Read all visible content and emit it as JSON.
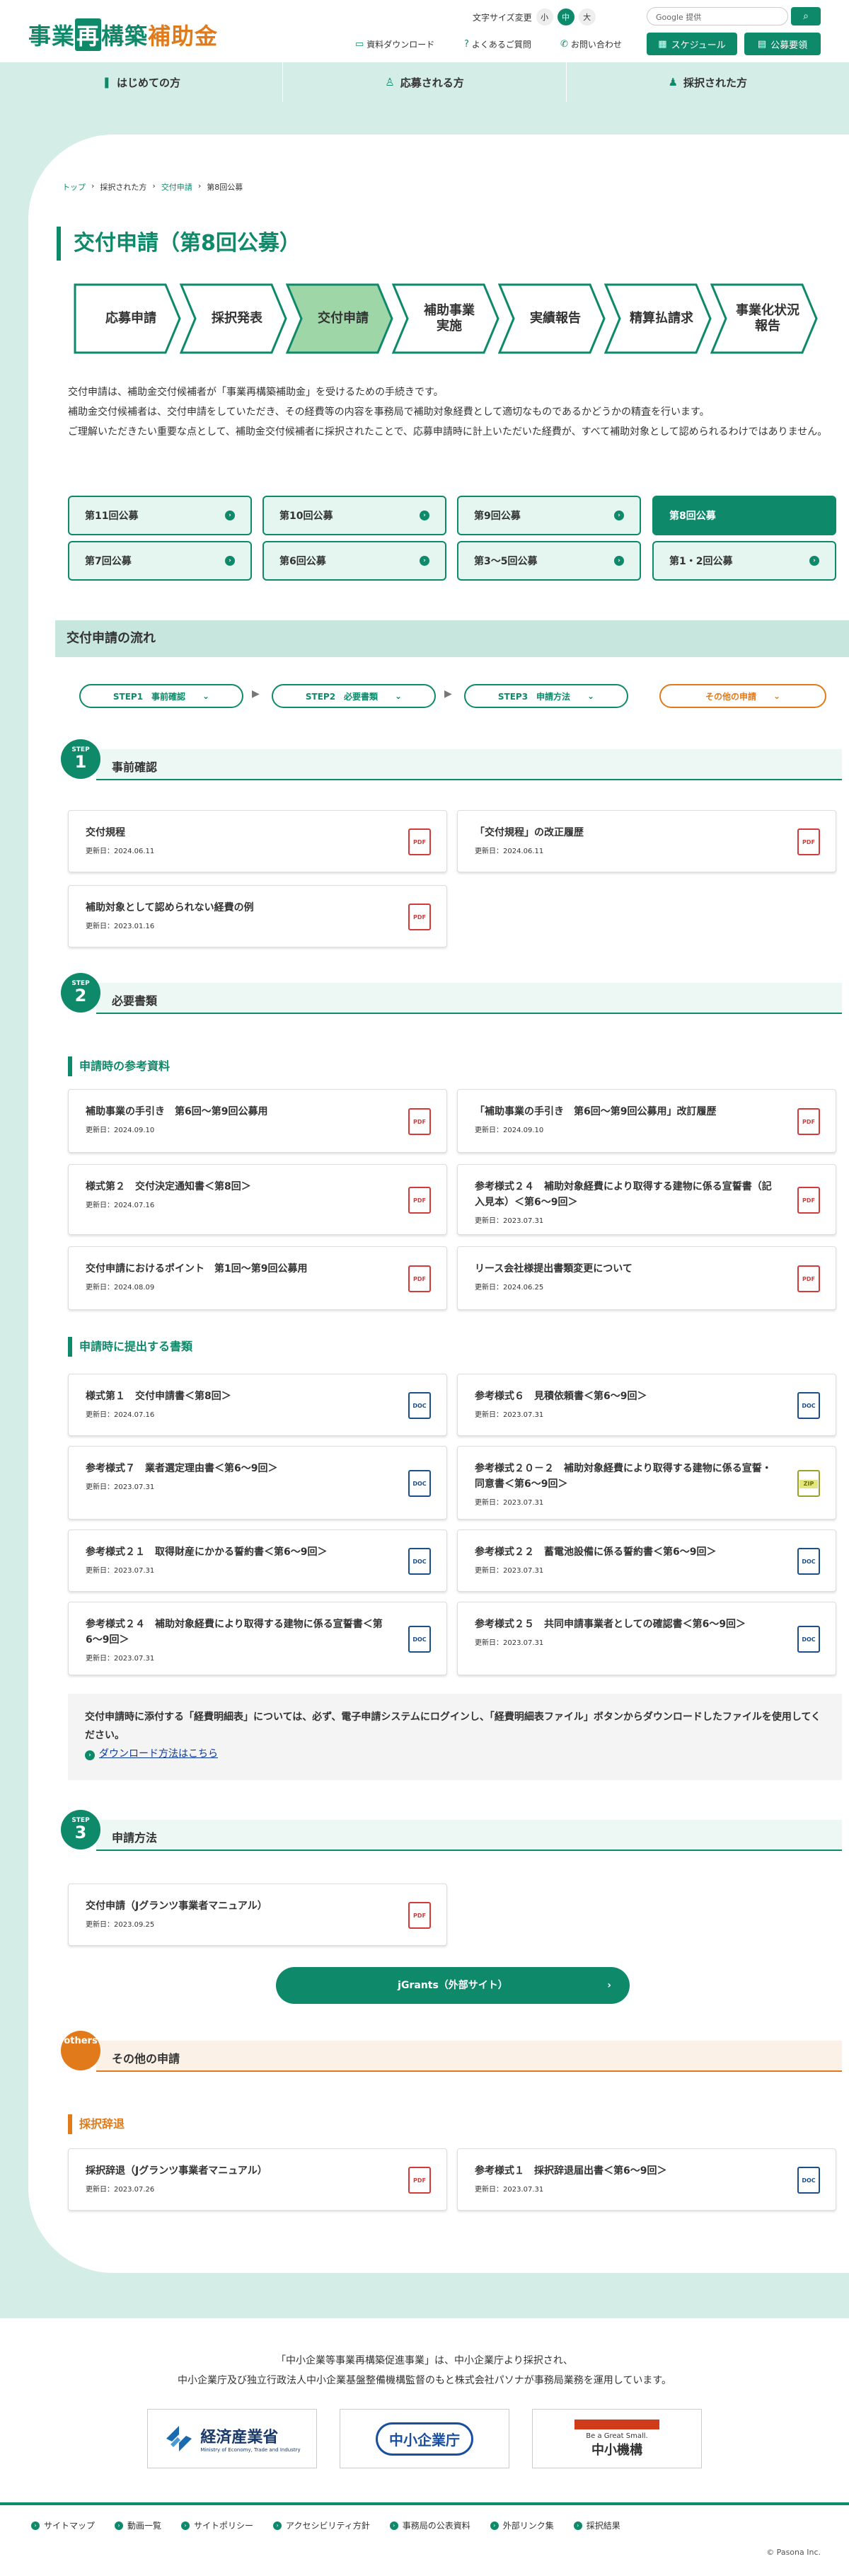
{
  "header": {
    "logo_a": "事業",
    "logo_box": "再",
    "logo_b": "構築",
    "logo_c": "補助金",
    "font_size_label": "文字サイズ変更",
    "font_small": "小",
    "font_mid": "中",
    "font_large": "大",
    "search_placeholder": "Google 提供",
    "links": [
      "資料ダウンロード",
      "よくあるご質問",
      "お問い合わせ"
    ],
    "schedule": "スケジュール",
    "guidelines": "公募要領"
  },
  "nav": [
    "はじめての方",
    "応募される方",
    "採択された方"
  ],
  "breadcrumb": [
    "トップ",
    "採択された方",
    "交付申請",
    "第8回公募"
  ],
  "page_title": "交付申請（第8回公募）",
  "steps": [
    "応募申請",
    "採択発表",
    "交付申請",
    "補助事業\n実施",
    "実績報告",
    "精算払請求",
    "事業化状況\n報告"
  ],
  "intro": [
    "交付申請は、補助金交付候補者が「事業再構築補助金」を受けるための手続きです。",
    "補助金交付候補者は、交付申請をしていただき、その経費等の内容を事務局で補助対象経費として適切なものであるかどうかの精査を行います。",
    "ご理解いただきたい重要な点として、補助金交付候補者に採択されたことで、応募申請時に計上いただいた経費が、すべて補助対象として認められるわけではありません。"
  ],
  "rounds": [
    "第11回公募",
    "第10回公募",
    "第9回公募",
    "第8回公募",
    "第7回公募",
    "第6回公募",
    "第3〜5回公募",
    "第1・2回公募"
  ],
  "flow": {
    "title": "交付申請の流れ",
    "pills": [
      "STEP1　事前確認",
      "STEP2　必要書類",
      "STEP3　申請方法",
      "その他の申請"
    ]
  },
  "step1": {
    "label": "STEP",
    "num": "1",
    "title": "事前確認",
    "items": [
      {
        "t": "交付規程",
        "d": "更新日：2024.06.11",
        "ic": "PDF"
      },
      {
        "t": "「交付規程」の改正履歴",
        "d": "更新日：2024.06.11",
        "ic": "PDF"
      },
      {
        "t": "補助対象として認められない経費の例",
        "d": "更新日：2023.01.16",
        "ic": "PDF"
      }
    ]
  },
  "step2": {
    "label": "STEP",
    "num": "2",
    "title": "必要書類",
    "sub1": "申請時の参考資料",
    "items1": [
      {
        "t": "補助事業の手引き　第6回〜第9回公募用",
        "d": "更新日：2024.09.10",
        "ic": "PDF"
      },
      {
        "t": "「補助事業の手引き　第6回〜第9回公募用」改訂履歴",
        "d": "更新日：2024.09.10",
        "ic": "PDF"
      },
      {
        "t": "様式第２　交付決定通知書＜第8回＞",
        "d": "更新日：2024.07.16",
        "ic": "PDF"
      },
      {
        "t": "参考様式２４　補助対象経費により取得する建物に係る宣誓書（記入見本）＜第6〜9回＞",
        "d": "更新日：2023.07.31",
        "ic": "PDF"
      },
      {
        "t": "交付申請におけるポイント　第1回〜第9回公募用",
        "d": "更新日：2024.08.09",
        "ic": "PDF"
      },
      {
        "t": "リース会社様提出書類変更について",
        "d": "更新日：2024.06.25",
        "ic": "PDF"
      }
    ],
    "sub2": "申請時に提出する書類",
    "items2": [
      {
        "t": "様式第１　交付申請書＜第8回＞",
        "d": "更新日：2024.07.16",
        "ic": "DOC"
      },
      {
        "t": "参考様式６　見積依頼書＜第6〜9回＞",
        "d": "更新日：2023.07.31",
        "ic": "DOC"
      },
      {
        "t": "参考様式７　業者選定理由書＜第6〜9回＞",
        "d": "更新日：2023.07.31",
        "ic": "DOC"
      },
      {
        "t": "参考様式２０－２　補助対象経費により取得する建物に係る宣誓・同意書＜第6〜9回＞",
        "d": "更新日：2023.07.31",
        "ic": "ZIP"
      },
      {
        "t": "参考様式２１　取得財産にかかる誓約書＜第6〜9回＞",
        "d": "更新日：2023.07.31",
        "ic": "DOC"
      },
      {
        "t": "参考様式２２　蓄電池設備に係る誓約書＜第6〜9回＞",
        "d": "更新日：2023.07.31",
        "ic": "DOC"
      },
      {
        "t": "参考様式２４　補助対象経費により取得する建物に係る宣誓書＜第6〜9回＞",
        "d": "更新日：2023.07.31",
        "ic": "DOC"
      },
      {
        "t": "参考様式２５　共同申請事業者としての確認書＜第6〜9回＞",
        "d": "更新日：2023.07.31",
        "ic": "DOC"
      }
    ],
    "note": "交付申請時に添付する「経費明細表」については、必ず、電子申請システムにログインし、「経費明細表ファイル」ボタンからダウンロードしたファイルを使用してください。",
    "note_link": "ダウンロード方法はこちら"
  },
  "step3": {
    "label": "STEP",
    "num": "3",
    "title": "申請方法",
    "items": [
      {
        "t": "交付申請（Jグランツ事業者マニュアル）",
        "d": "更新日：2023.09.25",
        "ic": "PDF"
      }
    ],
    "button": "jGrants（外部サイト）"
  },
  "others": {
    "label": "others",
    "title": "その他の申請",
    "sub": "採択辞退",
    "items": [
      {
        "t": "採択辞退（Jグランツ事業者マニュアル）",
        "d": "更新日：2023.07.26",
        "ic": "PDF"
      },
      {
        "t": "参考様式１　採択辞退届出書＜第6〜9回＞",
        "d": "更新日：2023.07.31",
        "ic": "DOC"
      }
    ]
  },
  "footer": {
    "text1": "「中小企業等事業再構築促進事業」は、中小企業庁より採択され、",
    "text2": "中小企業庁及び独立行政法人中小企業基盤整備機構監督のもと株式会社パソナが事務局業務を運用しています。",
    "logo1": "経済産業省",
    "logo1_sub": "Ministry of Economy, Trade and Industry",
    "logo2": "中小企業庁",
    "logo3a": "Be a Great Small.",
    "logo3b": "中小機構",
    "links": [
      "サイトマップ",
      "動画一覧",
      "サイトポリシー",
      "アクセシビリティ方針",
      "事務局の公表資料",
      "外部リンク集",
      "採択結果"
    ],
    "copyright": "© Pasona Inc."
  },
  "colors": {
    "brand": "#0e8a6b",
    "accent": "#e07a1a",
    "pdf": "#d23b3b",
    "doc": "#1a4f8a"
  }
}
